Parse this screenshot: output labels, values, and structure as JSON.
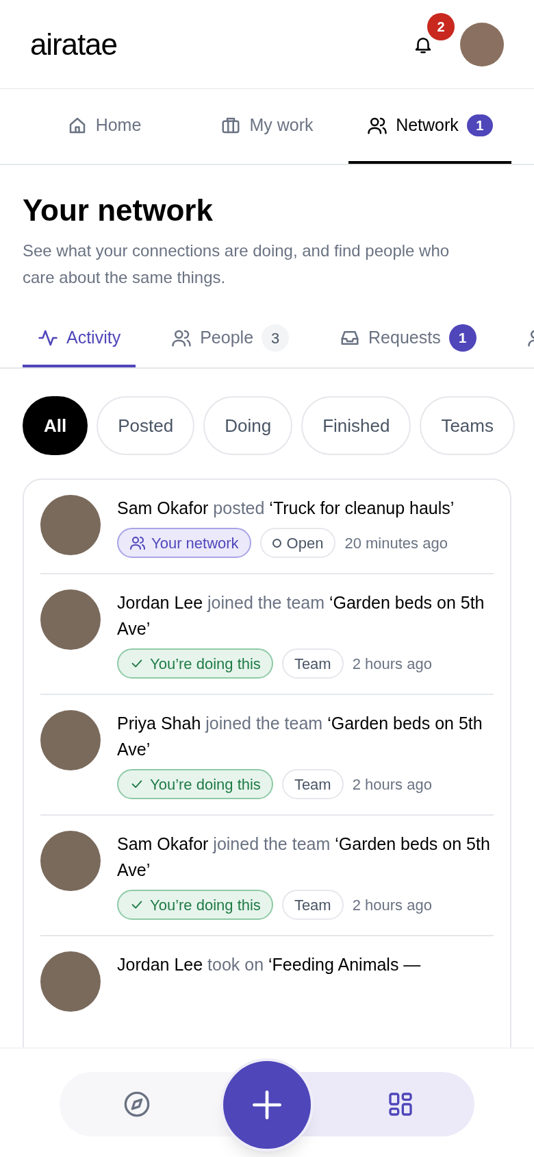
{
  "header": {
    "logo": "airatae",
    "notifications": {
      "count": "2"
    }
  },
  "main_tabs": [
    {
      "label": "Home",
      "selected": false
    },
    {
      "label": "My work",
      "selected": false
    },
    {
      "label": "Network",
      "selected": true,
      "badge": "1"
    }
  ],
  "page": {
    "title": "Your network",
    "subtitle": "See what your connections are doing, and find people who care about the same things."
  },
  "sub_tabs": [
    {
      "label": "Activity",
      "selected": true
    },
    {
      "label": "People",
      "selected": false,
      "count": "3"
    },
    {
      "label": "Requests",
      "selected": false,
      "badge": "1"
    },
    {
      "selected": false
    }
  ],
  "filters": [
    {
      "label": "All",
      "selected": true
    },
    {
      "label": "Posted",
      "selected": false
    },
    {
      "label": "Doing",
      "selected": false
    },
    {
      "label": "Finished",
      "selected": false
    },
    {
      "label": "Teams",
      "selected": false
    }
  ],
  "activity": [
    {
      "name": "Sam Okafor",
      "action": "posted",
      "title": "‘Truck for cleanup hauls’",
      "tags": [
        {
          "kind": "network",
          "label": "Your network"
        },
        {
          "kind": "status",
          "label": "Open"
        }
      ],
      "time": "20 minutes ago"
    },
    {
      "name": "Jordan Lee",
      "action": "joined the team",
      "title": "‘Garden beds on 5th Ave’",
      "tags": [
        {
          "kind": "doing",
          "label": "You’re doing this"
        },
        {
          "kind": "plain",
          "label": "Team"
        }
      ],
      "time": "2 hours ago"
    },
    {
      "name": "Priya Shah",
      "action": "joined the team",
      "title": "‘Garden beds on 5th Ave’",
      "tags": [
        {
          "kind": "doing",
          "label": "You’re doing this"
        },
        {
          "kind": "plain",
          "label": "Team"
        }
      ],
      "time": "2 hours ago"
    },
    {
      "name": "Sam Okafor",
      "action": "joined the team",
      "title": "‘Garden beds on 5th Ave’",
      "tags": [
        {
          "kind": "doing",
          "label": "You’re doing this"
        },
        {
          "kind": "plain",
          "label": "Team"
        }
      ],
      "time": "2 hours ago"
    },
    {
      "name": "Jordan Lee",
      "action": "took on",
      "title": "‘Feeding Animals —"
    }
  ],
  "bottom_nav": [
    {
      "selected": false
    },
    {
      "selected": true
    }
  ]
}
